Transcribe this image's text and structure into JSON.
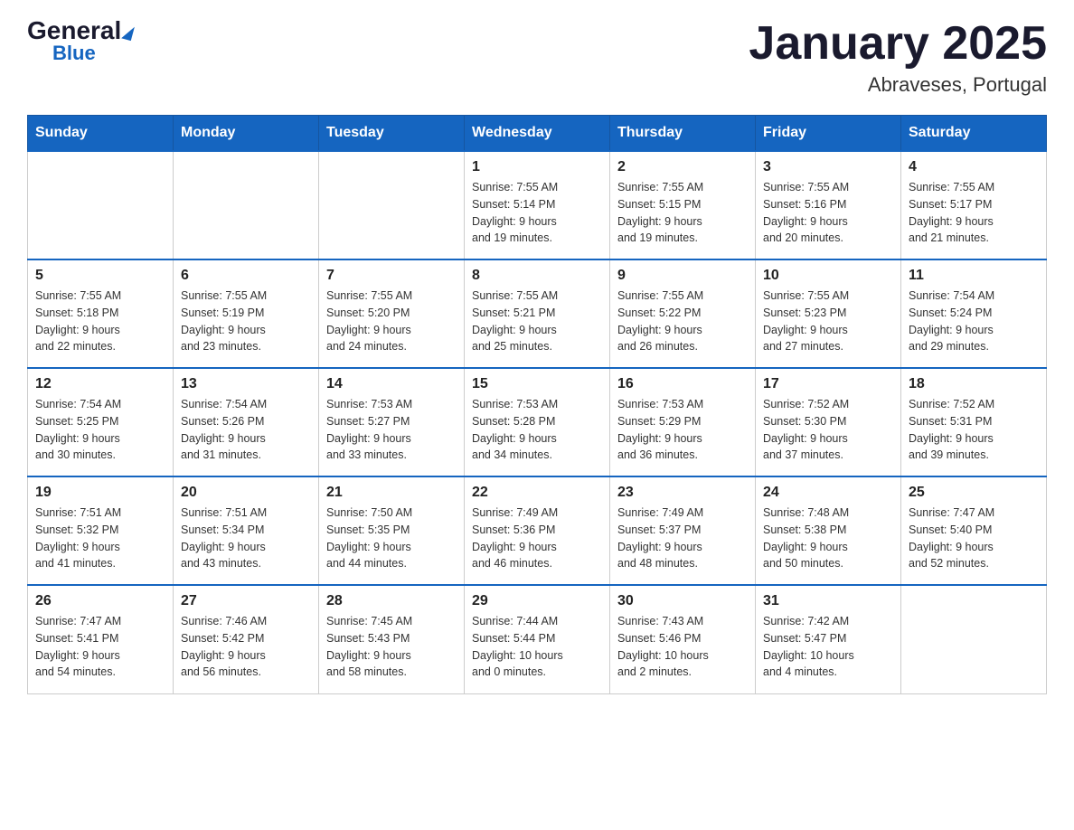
{
  "header": {
    "logo_general": "General",
    "logo_triangle": "▼",
    "logo_blue": "Blue",
    "title": "January 2025",
    "subtitle": "Abraveses, Portugal"
  },
  "days_of_week": [
    "Sunday",
    "Monday",
    "Tuesday",
    "Wednesday",
    "Thursday",
    "Friday",
    "Saturday"
  ],
  "weeks": [
    [
      {
        "day": "",
        "info": ""
      },
      {
        "day": "",
        "info": ""
      },
      {
        "day": "",
        "info": ""
      },
      {
        "day": "1",
        "info": "Sunrise: 7:55 AM\nSunset: 5:14 PM\nDaylight: 9 hours\nand 19 minutes."
      },
      {
        "day": "2",
        "info": "Sunrise: 7:55 AM\nSunset: 5:15 PM\nDaylight: 9 hours\nand 19 minutes."
      },
      {
        "day": "3",
        "info": "Sunrise: 7:55 AM\nSunset: 5:16 PM\nDaylight: 9 hours\nand 20 minutes."
      },
      {
        "day": "4",
        "info": "Sunrise: 7:55 AM\nSunset: 5:17 PM\nDaylight: 9 hours\nand 21 minutes."
      }
    ],
    [
      {
        "day": "5",
        "info": "Sunrise: 7:55 AM\nSunset: 5:18 PM\nDaylight: 9 hours\nand 22 minutes."
      },
      {
        "day": "6",
        "info": "Sunrise: 7:55 AM\nSunset: 5:19 PM\nDaylight: 9 hours\nand 23 minutes."
      },
      {
        "day": "7",
        "info": "Sunrise: 7:55 AM\nSunset: 5:20 PM\nDaylight: 9 hours\nand 24 minutes."
      },
      {
        "day": "8",
        "info": "Sunrise: 7:55 AM\nSunset: 5:21 PM\nDaylight: 9 hours\nand 25 minutes."
      },
      {
        "day": "9",
        "info": "Sunrise: 7:55 AM\nSunset: 5:22 PM\nDaylight: 9 hours\nand 26 minutes."
      },
      {
        "day": "10",
        "info": "Sunrise: 7:55 AM\nSunset: 5:23 PM\nDaylight: 9 hours\nand 27 minutes."
      },
      {
        "day": "11",
        "info": "Sunrise: 7:54 AM\nSunset: 5:24 PM\nDaylight: 9 hours\nand 29 minutes."
      }
    ],
    [
      {
        "day": "12",
        "info": "Sunrise: 7:54 AM\nSunset: 5:25 PM\nDaylight: 9 hours\nand 30 minutes."
      },
      {
        "day": "13",
        "info": "Sunrise: 7:54 AM\nSunset: 5:26 PM\nDaylight: 9 hours\nand 31 minutes."
      },
      {
        "day": "14",
        "info": "Sunrise: 7:53 AM\nSunset: 5:27 PM\nDaylight: 9 hours\nand 33 minutes."
      },
      {
        "day": "15",
        "info": "Sunrise: 7:53 AM\nSunset: 5:28 PM\nDaylight: 9 hours\nand 34 minutes."
      },
      {
        "day": "16",
        "info": "Sunrise: 7:53 AM\nSunset: 5:29 PM\nDaylight: 9 hours\nand 36 minutes."
      },
      {
        "day": "17",
        "info": "Sunrise: 7:52 AM\nSunset: 5:30 PM\nDaylight: 9 hours\nand 37 minutes."
      },
      {
        "day": "18",
        "info": "Sunrise: 7:52 AM\nSunset: 5:31 PM\nDaylight: 9 hours\nand 39 minutes."
      }
    ],
    [
      {
        "day": "19",
        "info": "Sunrise: 7:51 AM\nSunset: 5:32 PM\nDaylight: 9 hours\nand 41 minutes."
      },
      {
        "day": "20",
        "info": "Sunrise: 7:51 AM\nSunset: 5:34 PM\nDaylight: 9 hours\nand 43 minutes."
      },
      {
        "day": "21",
        "info": "Sunrise: 7:50 AM\nSunset: 5:35 PM\nDaylight: 9 hours\nand 44 minutes."
      },
      {
        "day": "22",
        "info": "Sunrise: 7:49 AM\nSunset: 5:36 PM\nDaylight: 9 hours\nand 46 minutes."
      },
      {
        "day": "23",
        "info": "Sunrise: 7:49 AM\nSunset: 5:37 PM\nDaylight: 9 hours\nand 48 minutes."
      },
      {
        "day": "24",
        "info": "Sunrise: 7:48 AM\nSunset: 5:38 PM\nDaylight: 9 hours\nand 50 minutes."
      },
      {
        "day": "25",
        "info": "Sunrise: 7:47 AM\nSunset: 5:40 PM\nDaylight: 9 hours\nand 52 minutes."
      }
    ],
    [
      {
        "day": "26",
        "info": "Sunrise: 7:47 AM\nSunset: 5:41 PM\nDaylight: 9 hours\nand 54 minutes."
      },
      {
        "day": "27",
        "info": "Sunrise: 7:46 AM\nSunset: 5:42 PM\nDaylight: 9 hours\nand 56 minutes."
      },
      {
        "day": "28",
        "info": "Sunrise: 7:45 AM\nSunset: 5:43 PM\nDaylight: 9 hours\nand 58 minutes."
      },
      {
        "day": "29",
        "info": "Sunrise: 7:44 AM\nSunset: 5:44 PM\nDaylight: 10 hours\nand 0 minutes."
      },
      {
        "day": "30",
        "info": "Sunrise: 7:43 AM\nSunset: 5:46 PM\nDaylight: 10 hours\nand 2 minutes."
      },
      {
        "day": "31",
        "info": "Sunrise: 7:42 AM\nSunset: 5:47 PM\nDaylight: 10 hours\nand 4 minutes."
      },
      {
        "day": "",
        "info": ""
      }
    ]
  ]
}
